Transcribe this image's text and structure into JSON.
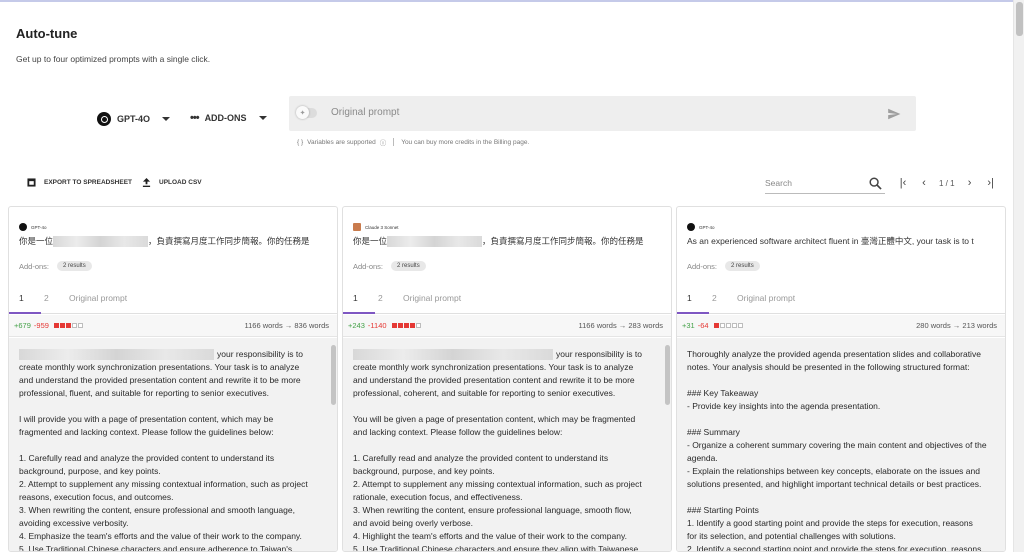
{
  "header": {
    "title": "Auto-tune",
    "subtitle": "Get up to four optimized prompts with a single click."
  },
  "controls": {
    "model_label": "GPT-4O",
    "addons_label": "ADD-ONS",
    "prompt_placeholder": "Original prompt",
    "hint_variables": "Variables are supported",
    "hint_credits": "You can buy more credits in the Billing page."
  },
  "toolbar": {
    "export_label": "EXPORT TO SPREADSHEET",
    "upload_label": "UPLOAD CSV",
    "search_placeholder": "Search",
    "page_indicator": "1 / 1"
  },
  "cards": [
    {
      "model": "GPT-4o",
      "first_line_prefix": "你是一位",
      "first_line_suffix": "，負責撰寫月度工作同步簡報。你的任務是",
      "addons_label": "Add-ons:",
      "addons_badge": "2 results",
      "tabs": [
        "1",
        "2",
        "Original prompt"
      ],
      "plus": "+679",
      "minus": "-959",
      "blocks_filled": 3,
      "words": "1166 words → 836 words",
      "body_suffix": "your responsibility is to",
      "body": "create monthly work synchronization presentations. Your task is to analyze\nand understand the provided presentation content and rewrite it to be more\nprofessional, fluent, and suitable for reporting to senior executives.\n\nI will provide you with a page of presentation content, which may be\nfragmented and lacking context. Please follow the guidelines below:\n\n1. Carefully read and analyze the provided content to understand its\nbackground, purpose, and key points.\n2. Attempt to supplement any missing contextual information, such as project\nreasons, execution focus, and outcomes.\n3. When rewriting the content, ensure professional and smooth language,\navoiding excessive verbosity.\n4. Emphasize the team's efforts and the value of their work to the company.\n5. Use Traditional Chinese characters and ensure adherence to Taiwan's"
    },
    {
      "model": "Claude 3 Sonnet",
      "first_line_prefix": "你是一位",
      "first_line_suffix": "，負責撰寫月度工作同步簡報。你的任務是",
      "addons_label": "Add-ons:",
      "addons_badge": "2 results",
      "tabs": [
        "1",
        "2",
        "Original prompt"
      ],
      "plus": "+243",
      "minus": "-1140",
      "blocks_filled": 4,
      "words": "1166 words → 283 words",
      "body_suffix": "your responsibility is to",
      "body": "create monthly work synchronization presentations. Your task is to analyze\nand understand the provided presentation content and rewrite it to be more\nprofessional, coherent, and suitable for reporting to senior executives.\n\nYou will be given a page of presentation content, which may be fragmented\nand lacking context. Please follow the guidelines below:\n\n1. Carefully read and analyze the provided content to understand its\nbackground, purpose, and key points.\n2. Attempt to supplement any missing contextual information, such as project\nrationale, execution focus, and effectiveness.\n3. When rewriting the content, ensure professional language, smooth flow,\nand avoid being overly verbose.\n4. Highlight the team's efforts and the value of their work to the company.\n5. Use Traditional Chinese characters and ensure they align with Taiwanese"
    },
    {
      "model": "GPT-4o",
      "first_line_text": "As an experienced software architect fluent in 臺灣正體中文, your task is to t",
      "addons_label": "Add-ons:",
      "addons_badge": "2 results",
      "tabs": [
        "1",
        "2",
        "Original prompt"
      ],
      "plus": "+31",
      "minus": "-64",
      "blocks_filled": 1,
      "words": "280 words → 213 words",
      "body": "Thoroughly analyze the provided agenda presentation slides and collaborative\nnotes. Your analysis should be presented in the following structured format:\n\n### Key Takeaway\n- Provide key insights into the agenda presentation.\n\n### Summary\n- Organize a coherent summary covering the main content and objectives of the\nagenda.\n- Explain the relationships between key concepts, elaborate on the issues and\nsolutions presented, and highlight important technical details or best practices.\n\n### Starting Points\n1. Identify a good starting point and provide the steps for execution, reasons\nfor its selection, and potential challenges with solutions.\n2. Identify a second starting point and provide the steps for execution, reasons"
    }
  ]
}
